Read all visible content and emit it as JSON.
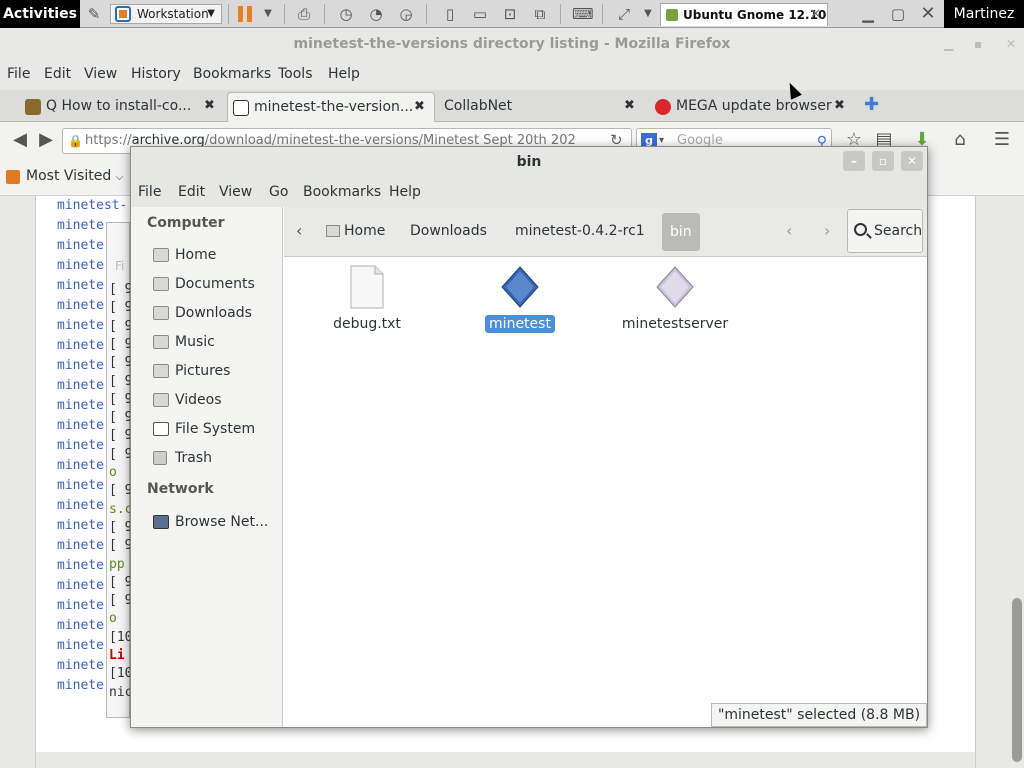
{
  "topbar": {
    "activities": "Activities",
    "vm_name": "Workstation",
    "vm_tab": "Ubuntu Gnome 12.10",
    "user": "Martinez"
  },
  "firefox": {
    "window_title": "minetest-the-versions directory listing - Mozilla Firefox",
    "menu": {
      "file": "File",
      "edit": "Edit",
      "view": "View",
      "history": "History",
      "bookmarks": "Bookmarks",
      "tools": "Tools",
      "help": "Help"
    },
    "tabs": [
      {
        "label": "Q How to install-co...",
        "icon": "tab-favicon"
      },
      {
        "label": "minetest-the-version...",
        "icon": "archive-icon"
      },
      {
        "label": "CollabNet",
        "icon": ""
      },
      {
        "label": "MEGA update browser",
        "icon": "mega-icon"
      }
    ],
    "url_prefix": "https://",
    "url_host": "archive.org",
    "url_rest": "/download/minetest-the-versions/Minetest Sept 20th 202",
    "search_placeholder": "Google",
    "bookmarks_toolbar": {
      "most_visited": "Most Visited"
    }
  },
  "page_behind": {
    "dir_link_text": "minete",
    "first_link": "minetest-",
    "log_lines": [
      "[ 9",
      "[ 9",
      "[ 9",
      "[ 9",
      "[ 9",
      "[ 9",
      "[ 9",
      "[ 9",
      "[ 9",
      "[ 9",
      "o",
      "[ 9",
      "s.c",
      "[ 9",
      "[ 9",
      "pp",
      "[ 9",
      "[ 9",
      "o",
      "[10",
      "Li",
      "[10",
      "nic"
    ],
    "dimmed_label": "Fi"
  },
  "nautilus": {
    "title": "bin",
    "menu": {
      "file": "File",
      "edit": "Edit",
      "view": "View",
      "go": "Go",
      "bookmarks": "Bookmarks",
      "help": "Help"
    },
    "sidebar": {
      "computer_heading": "Computer",
      "items": [
        {
          "label": "Home",
          "icon": "home-folder-icon"
        },
        {
          "label": "Documents",
          "icon": "documents-folder-icon"
        },
        {
          "label": "Downloads",
          "icon": "downloads-folder-icon"
        },
        {
          "label": "Music",
          "icon": "music-folder-icon"
        },
        {
          "label": "Pictures",
          "icon": "pictures-folder-icon"
        },
        {
          "label": "Videos",
          "icon": "videos-folder-icon"
        },
        {
          "label": "File System",
          "icon": "filesystem-icon"
        },
        {
          "label": "Trash",
          "icon": "trash-icon"
        }
      ],
      "network_heading": "Network",
      "network_items": [
        {
          "label": "Browse Net...",
          "icon": "network-icon"
        }
      ]
    },
    "pathbar": {
      "crumbs": [
        "Home",
        "Downloads",
        "minetest-0.4.2-rc1",
        "bin"
      ],
      "search_label": "Search"
    },
    "files": [
      {
        "name": "debug.txt",
        "icon": "text-file-icon",
        "selected": false
      },
      {
        "name": "minetest",
        "icon": "executable-icon",
        "selected": true
      },
      {
        "name": "minetestserver",
        "icon": "executable-icon",
        "selected": false
      }
    ],
    "status": "\"minetest\" selected (8.8 MB)"
  }
}
